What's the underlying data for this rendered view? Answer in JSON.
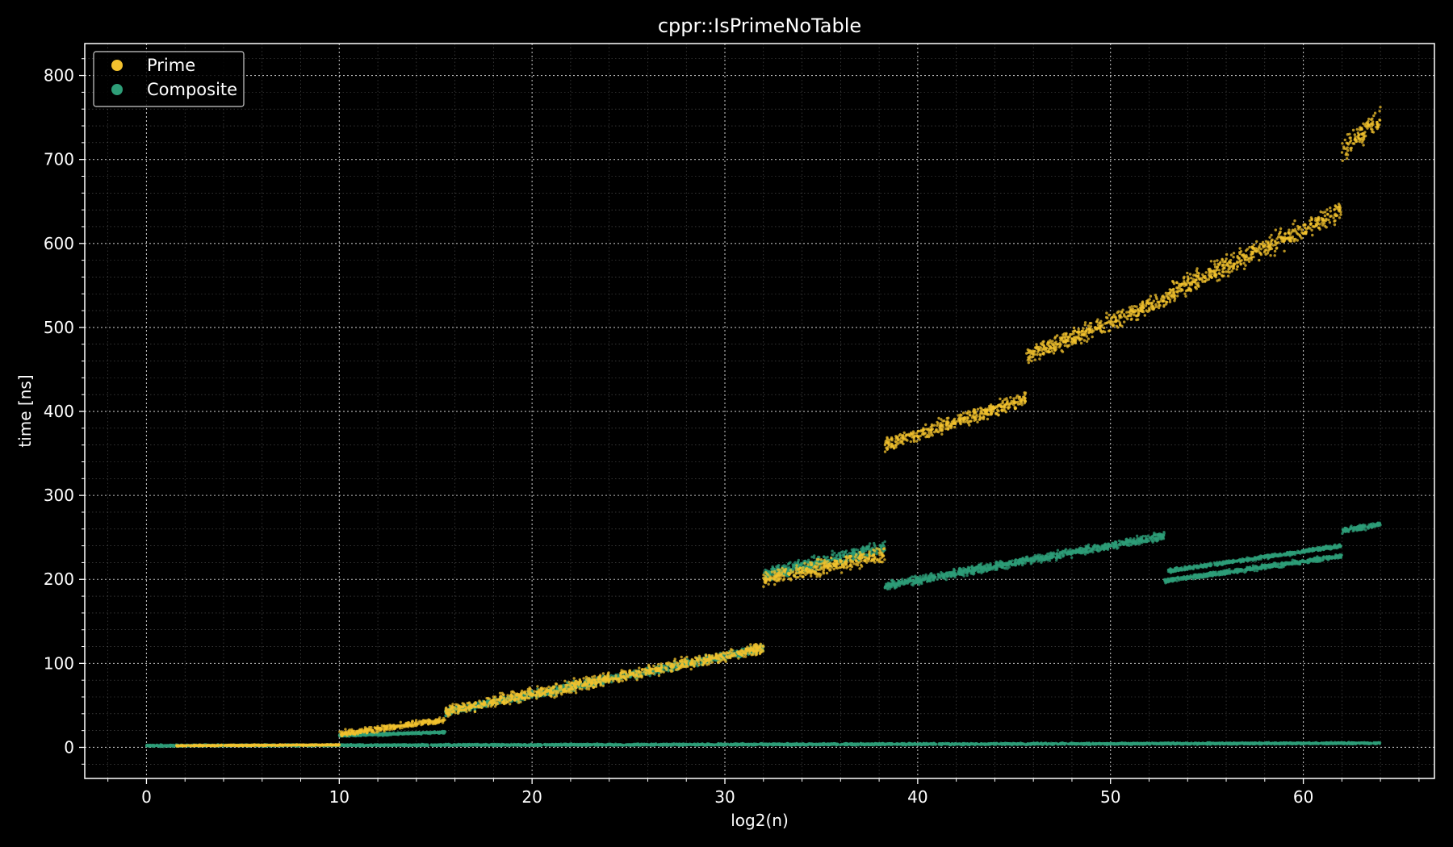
{
  "chart_data": {
    "type": "scatter",
    "title": "cppr::IsPrimeNoTable",
    "xlabel": "log2(n)",
    "ylabel": "time [ns]",
    "xlim": [
      -3.2,
      66.8
    ],
    "ylim": [
      -37,
      838
    ],
    "xticks": [
      0,
      10,
      20,
      30,
      40,
      50,
      60
    ],
    "yticks": [
      0,
      100,
      200,
      300,
      400,
      500,
      600,
      700,
      800
    ],
    "x_tick_labels": [
      "0",
      "10",
      "20",
      "30",
      "40",
      "50",
      "60"
    ],
    "y_tick_labels": [
      "0",
      "100",
      "200",
      "300",
      "400",
      "500",
      "600",
      "700",
      "800"
    ],
    "grid": true,
    "grid_style": "dotted, major and minor",
    "legend_position": "top-left",
    "series": [
      {
        "name": "Prime",
        "color": "#f2c12e",
        "segments": [
          {
            "x": [
              1.5,
              10
            ],
            "y": [
              2,
              3
            ],
            "spread": 1
          },
          {
            "x": [
              10,
              15.5
            ],
            "y": [
              16,
              33
            ],
            "spread": 5
          },
          {
            "x": [
              15.5,
              32
            ],
            "y": [
              43,
              118
            ],
            "spread": 10
          },
          {
            "x": [
              32,
              38.3
            ],
            "y": [
              200,
              230
            ],
            "spread": 14
          },
          {
            "x": [
              38.3,
              45.6
            ],
            "y": [
              360,
              415
            ],
            "spread": 12
          },
          {
            "x": [
              45.6,
              53
            ],
            "y": [
              465,
              535
            ],
            "spread": 15
          },
          {
            "x": [
              53,
              62
            ],
            "y": [
              540,
              640
            ],
            "spread": 18
          },
          {
            "x": [
              62,
              64
            ],
            "y": [
              710,
              750
            ],
            "spread": 20
          }
        ]
      },
      {
        "name": "Composite",
        "color": "#2e9e78",
        "segments": [
          {
            "x": [
              0,
              64
            ],
            "y": [
              2,
              5
            ],
            "spread": 1.5
          },
          {
            "x": [
              10,
              15.5
            ],
            "y": [
              14,
              18
            ],
            "spread": 2
          },
          {
            "x": [
              15.5,
              32
            ],
            "y": [
              42,
              118
            ],
            "spread": 7
          },
          {
            "x": [
              32,
              38.3
            ],
            "y": [
              205,
              238
            ],
            "spread": 12
          },
          {
            "x": [
              38.3,
              52.8
            ],
            "y": [
              192,
              252
            ],
            "spread": 7
          },
          {
            "x": [
              52.8,
              62
            ],
            "y": [
              198,
              228
            ],
            "spread": 4
          },
          {
            "x": [
              53,
              62
            ],
            "y": [
              210,
              240
            ],
            "spread": 3
          },
          {
            "x": [
              62,
              64
            ],
            "y": [
              258,
              266
            ],
            "spread": 5
          }
        ]
      }
    ]
  }
}
